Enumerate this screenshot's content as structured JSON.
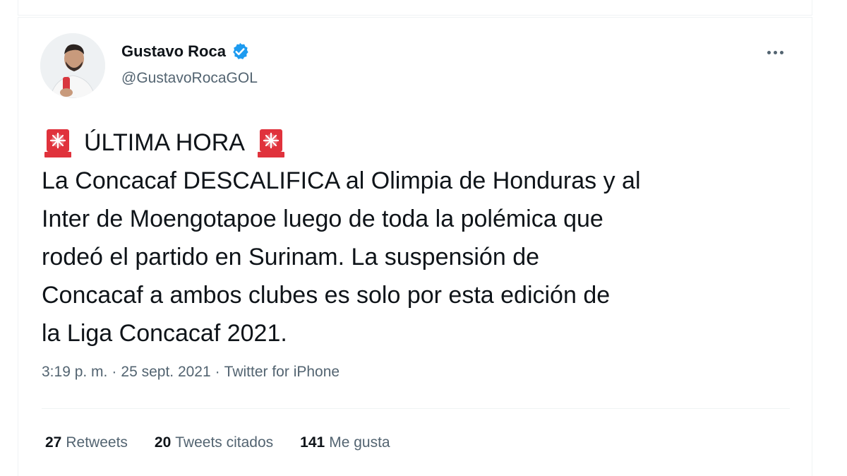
{
  "tweet": {
    "author": {
      "display_name": "Gustavo Roca",
      "handle": "@GustavoRocaGOL",
      "verified": true
    },
    "headline": "ÚLTIMA HORA",
    "headline_icon": "rotating-light-icon",
    "body_lines": [
      "La Concacaf DESCALIFICA al Olimpia de Honduras y al",
      "Inter de Moengotapoe luego de toda la polémica que",
      "rodeó el partido en Surinam. La suspensión de",
      "Concacaf a ambos clubes es solo por esta edición de",
      "la Liga Concacaf 2021."
    ],
    "time": "3:19 p. m.",
    "separator": "·",
    "date": "25 sept. 2021",
    "source": "Twitter for iPhone",
    "stats": {
      "retweets_count": "27",
      "retweets_label": "Retweets",
      "quotes_count": "20",
      "quotes_label": "Tweets citados",
      "likes_count": "141",
      "likes_label": "Me gusta"
    }
  },
  "colors": {
    "verified": "#1d9bf0",
    "siren": "#e0323c",
    "secondary_text": "#536471"
  }
}
